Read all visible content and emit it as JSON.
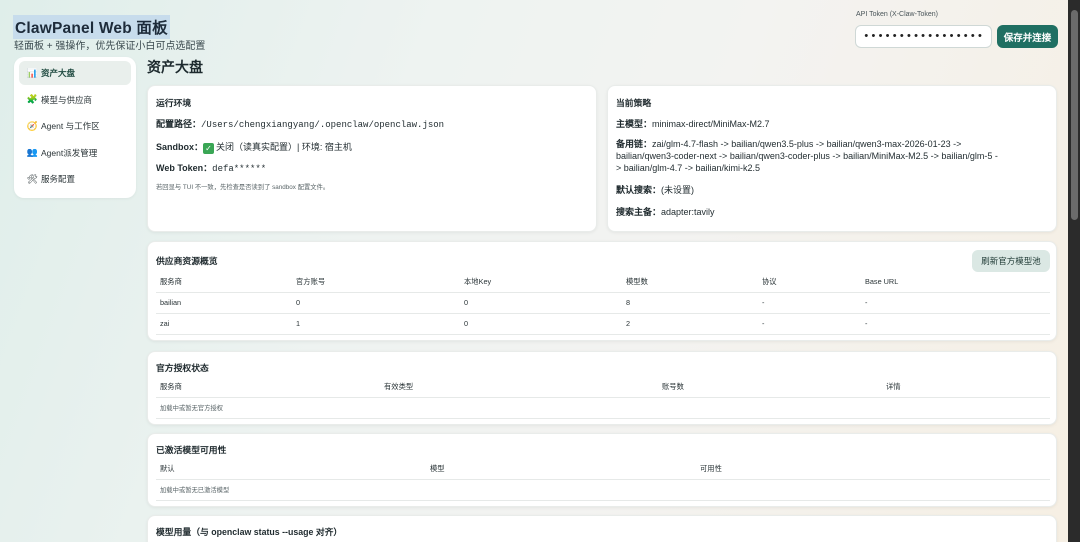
{
  "header": {
    "title": "ClawPanel Web 面板",
    "subtitle": "轻面板 + 强操作，优先保证小白可点选配置",
    "token_label": "API Token (X-Claw-Token)",
    "token_value": "•••••••••••••••••",
    "save_label": "保存并连接"
  },
  "sidebar": {
    "items": [
      {
        "icon": "📊",
        "label": "资产大盘"
      },
      {
        "icon": "🧩",
        "label": "模型与供应商"
      },
      {
        "icon": "🧭",
        "label": "Agent 与工作区"
      },
      {
        "icon": "👥",
        "label": "Agent派发管理"
      },
      {
        "icon": "🛠",
        "label": "服务配置"
      }
    ]
  },
  "page_title": "资产大盘",
  "runtime": {
    "title": "运行环境",
    "config_path_label": "配置路径：",
    "config_path_value": "/Users/chengxiangyang/.openclaw/openclaw.json",
    "sandbox_label": "Sandbox：",
    "sandbox_check": "✓",
    "sandbox_value": "关闭（读真实配置）| 环境: 宿主机",
    "web_token_label": "Web Token：",
    "web_token_value": "defa******",
    "note": "若回显与 TUI 不一致，先检查是否读到了 sandbox 配置文件。"
  },
  "strategy": {
    "title": "当前策略",
    "primary_label": "主模型：",
    "primary_value": "minimax-direct/MiniMax-M2.7",
    "fallback_label": "备用链：",
    "fallback_line1": "zai/glm-4.7-flash -> bailian/qwen3.5-plus -> bailian/qwen3-max-2026-01-23 ->",
    "fallback_line2": "bailian/qwen3-coder-next -> bailian/qwen3-coder-plus -> bailian/MiniMax-M2.5 -> bailian/glm-5 -",
    "fallback_line3": "> bailian/glm-4.7 -> bailian/kimi-k2.5",
    "search_label": "默认搜索：",
    "search_value": "(未设置)",
    "search_main_label": "搜索主备：",
    "search_main_value": "adapter:tavily"
  },
  "providers": {
    "title": "供应商资源概览",
    "refresh_label": "刷新官方模型池",
    "columns": [
      "服务商",
      "官方账号",
      "本地Key",
      "模型数",
      "协议",
      "Base URL"
    ],
    "rows": [
      [
        "bailian",
        "0",
        "0",
        "8",
        "-",
        "-"
      ],
      [
        "zai",
        "1",
        "0",
        "2",
        "-",
        "-"
      ]
    ]
  },
  "auth": {
    "title": "官方授权状态",
    "columns": [
      "服务商",
      "有效类型",
      "账号数",
      "详情"
    ],
    "empty": "加载中或暂无官方授权"
  },
  "activated": {
    "title": "已激活模型可用性",
    "columns": [
      "默认",
      "模型",
      "可用性"
    ],
    "empty": "加载中或暂无已激活模型"
  },
  "usage": {
    "title": "模型用量（与 openclaw status --usage 对齐）"
  },
  "colors": {
    "accent": "#1f6f62",
    "sidebar_active_bg": "#e9efec",
    "refresh_bg": "#dbe8e4"
  }
}
